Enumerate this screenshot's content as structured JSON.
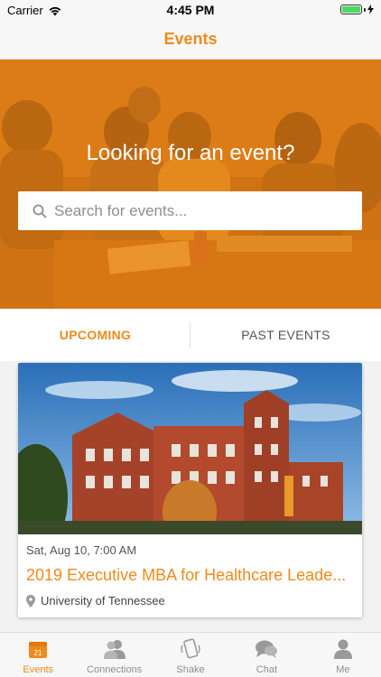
{
  "status_bar": {
    "carrier": "Carrier",
    "time": "4:45 PM"
  },
  "nav": {
    "title": "Events"
  },
  "hero": {
    "title": "Looking for an event?",
    "search_placeholder": "Search for events..."
  },
  "tabs": [
    {
      "label": "UPCOMING",
      "active": true
    },
    {
      "label": "PAST EVENTS",
      "active": false
    }
  ],
  "events": [
    {
      "date": "Sat, Aug 10, 7:00 AM",
      "title": "2019 Executive MBA for Healthcare Leade...",
      "location": "University of Tennessee"
    }
  ],
  "tab_bar": [
    {
      "label": "Events",
      "icon": "calendar-icon",
      "badge": "21",
      "selected": true
    },
    {
      "label": "Connections",
      "icon": "people-icon",
      "selected": false
    },
    {
      "label": "Shake",
      "icon": "shake-phone-icon",
      "selected": false
    },
    {
      "label": "Chat",
      "icon": "chat-bubbles-icon",
      "selected": false
    },
    {
      "label": "Me",
      "icon": "person-icon",
      "selected": false
    }
  ],
  "colors": {
    "accent": "#ef8a1c",
    "battery": "#4cd964"
  }
}
